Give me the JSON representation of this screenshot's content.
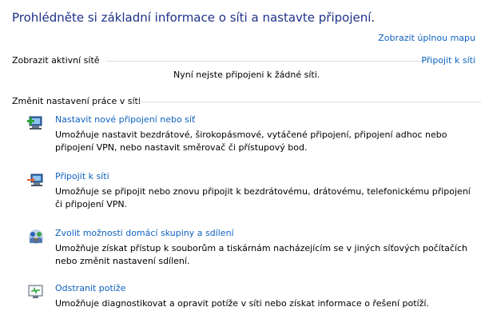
{
  "header": {
    "title": "Prohlédněte si základní informace o síti a nastavte připojení."
  },
  "links": {
    "full_map": "Zobrazit úplnou mapu",
    "connect": "Připojit k síti"
  },
  "active_networks": {
    "heading": "Zobrazit aktivní sítě",
    "status": "Nyní nejste připojeni k žádné síti."
  },
  "change_settings": {
    "heading": "Změnit nastavení práce v síti",
    "tasks": [
      {
        "icon": "new-connection-icon",
        "label": "Nastavit nové připojení nebo síť",
        "description": "Umožňuje nastavit bezdrátové, širokopásmové, vytáčené připojení, připojení adhoc nebo připojení VPN, nebo nastavit směrovač či přístupový bod."
      },
      {
        "icon": "connect-network-icon",
        "label": "Připojit k síti",
        "description": "Umožňuje se připojit nebo znovu připojit k bezdrátovému, drátovému, telefonickému připojení či připojení VPN."
      },
      {
        "icon": "homegroup-icon",
        "label": "Zvolit možnosti domácí skupiny a sdílení",
        "description": "Umožňuje získat přístup k souborům a tiskárnám nacházejícím se v jiných síťových počítačích nebo změnit nastavení sdílení."
      },
      {
        "icon": "troubleshoot-icon",
        "label": "Odstranit potíže",
        "description": "Umožňuje diagnostikovat a opravit potíže v síti nebo získat informace o řešení potíží."
      }
    ]
  },
  "colors": {
    "title": "#1e3287",
    "link": "#0f62c0",
    "rule": "#d5dfe5"
  }
}
